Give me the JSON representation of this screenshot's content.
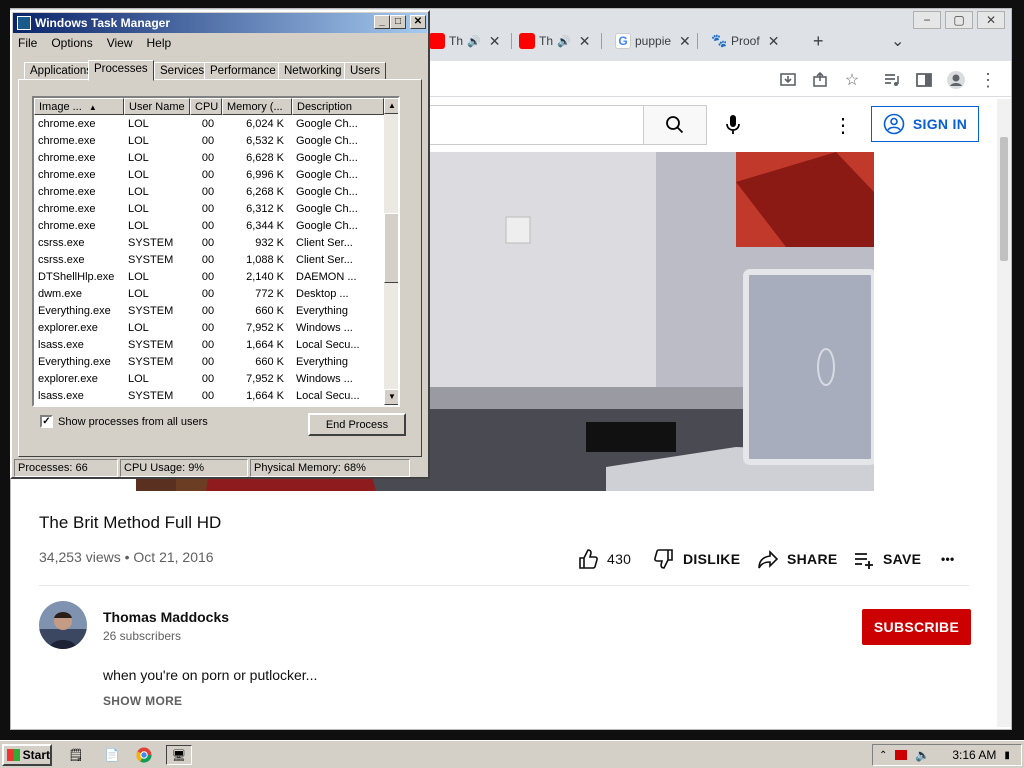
{
  "browser": {
    "tabs": [
      {
        "title": "Th",
        "favicon": "youtube-icon",
        "audio": true
      },
      {
        "title": "Th",
        "favicon": "youtube-icon",
        "audio": true
      },
      {
        "title": "puppie",
        "favicon": "google-icon",
        "audio": false
      },
      {
        "title": "Proof",
        "favicon": "paw-icon",
        "audio": false
      }
    ],
    "new_tab": "+",
    "tab_search": "⌄",
    "window_controls": {
      "minimize": "−",
      "maximize": "▢",
      "close": "✕"
    }
  },
  "youtube": {
    "sign_in": "SIGN IN",
    "video": {
      "title": "The Brit Method Full HD",
      "views": "34,253 views",
      "date": "Oct 21, 2016",
      "separator": "•",
      "likes": "430",
      "dislike_label": "DISLIKE",
      "share_label": "SHARE",
      "save_label": "SAVE",
      "more": "•••"
    },
    "channel": {
      "name": "Thomas Maddocks",
      "subscribers": "26 subscribers",
      "subscribe_label": "SUBSCRIBE"
    },
    "description": "when you're on porn or putlocker...",
    "show_more": "SHOW MORE"
  },
  "task_manager": {
    "title": "Windows Task Manager",
    "menu": [
      "File",
      "Options",
      "View",
      "Help"
    ],
    "tabs": [
      "Applications",
      "Processes",
      "Services",
      "Performance",
      "Networking",
      "Users"
    ],
    "active_tab": "Processes",
    "columns": [
      "Image ...",
      "User Name",
      "CPU",
      "Memory (...",
      "Description"
    ],
    "processes": [
      {
        "image": "chrome.exe",
        "user": "LOL",
        "cpu": "00",
        "memory": "6,024 K",
        "description": "Google Ch..."
      },
      {
        "image": "chrome.exe",
        "user": "LOL",
        "cpu": "00",
        "memory": "6,532 K",
        "description": "Google Ch..."
      },
      {
        "image": "chrome.exe",
        "user": "LOL",
        "cpu": "00",
        "memory": "6,628 K",
        "description": "Google Ch..."
      },
      {
        "image": "chrome.exe",
        "user": "LOL",
        "cpu": "00",
        "memory": "6,996 K",
        "description": "Google Ch..."
      },
      {
        "image": "chrome.exe",
        "user": "LOL",
        "cpu": "00",
        "memory": "6,268 K",
        "description": "Google Ch..."
      },
      {
        "image": "chrome.exe",
        "user": "LOL",
        "cpu": "00",
        "memory": "6,312 K",
        "description": "Google Ch..."
      },
      {
        "image": "chrome.exe",
        "user": "LOL",
        "cpu": "00",
        "memory": "6,344 K",
        "description": "Google Ch..."
      },
      {
        "image": "csrss.exe",
        "user": "SYSTEM",
        "cpu": "00",
        "memory": "932 K",
        "description": "Client Ser..."
      },
      {
        "image": "csrss.exe",
        "user": "SYSTEM",
        "cpu": "00",
        "memory": "1,088 K",
        "description": "Client Ser..."
      },
      {
        "image": "DTShellHlp.exe",
        "user": "LOL",
        "cpu": "00",
        "memory": "2,140 K",
        "description": "DAEMON ..."
      },
      {
        "image": "dwm.exe",
        "user": "LOL",
        "cpu": "00",
        "memory": "772 K",
        "description": "Desktop ..."
      },
      {
        "image": "Everything.exe",
        "user": "SYSTEM",
        "cpu": "00",
        "memory": "660 K",
        "description": "Everything"
      },
      {
        "image": "explorer.exe",
        "user": "LOL",
        "cpu": "00",
        "memory": "7,952 K",
        "description": "Windows ..."
      },
      {
        "image": "lsass.exe",
        "user": "SYSTEM",
        "cpu": "00",
        "memory": "1,664 K",
        "description": "Local Secu..."
      },
      {
        "image": "Everything.exe",
        "user": "SYSTEM",
        "cpu": "00",
        "memory": "660 K",
        "description": "Everything"
      },
      {
        "image": "explorer.exe",
        "user": "LOL",
        "cpu": "00",
        "memory": "7,952 K",
        "description": "Windows ..."
      },
      {
        "image": "lsass.exe",
        "user": "SYSTEM",
        "cpu": "00",
        "memory": "1,664 K",
        "description": "Local Secu..."
      }
    ],
    "show_all_users": "Show processes from all users",
    "show_all_checked": true,
    "end_process": "End Process",
    "status": {
      "processes": "Processes: 66",
      "cpu": "CPU Usage: 9%",
      "memory": "Physical Memory: 68%"
    }
  },
  "taskbar": {
    "start": "Start",
    "clock": "3:16 AM"
  },
  "colors": {
    "subscribe_red": "#cc0000",
    "youtube_blue": "#065fd4",
    "titlebar_start": "#0a246a",
    "titlebar_end": "#a6caf0",
    "win_gray": "#d4d0c8"
  }
}
